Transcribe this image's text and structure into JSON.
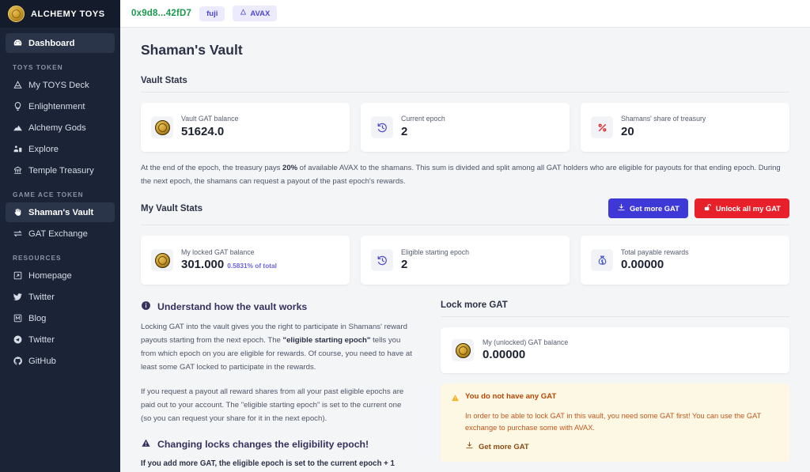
{
  "brand": {
    "name": "ALCHEMY TOYS",
    "logo_icon": "gold-coin-icon"
  },
  "sidebar": {
    "top_items": [
      {
        "label": "Dashboard",
        "icon": "dashboard-icon",
        "active": true
      }
    ],
    "groups": [
      {
        "title": "TOYS TOKEN",
        "items": [
          {
            "label": "My TOYS Deck",
            "icon": "deck-icon"
          },
          {
            "label": "Enlightenment",
            "icon": "lightbulb-icon"
          },
          {
            "label": "Alchemy Gods",
            "icon": "mountain-icon"
          },
          {
            "label": "Explore",
            "icon": "explore-icon"
          },
          {
            "label": "Temple Treasury",
            "icon": "temple-icon"
          }
        ]
      },
      {
        "title": "GAME ACE TOKEN",
        "items": [
          {
            "label": "Shaman's Vault",
            "icon": "hand-icon",
            "active": true
          },
          {
            "label": "GAT Exchange",
            "icon": "exchange-icon"
          }
        ]
      },
      {
        "title": "RESOURCES",
        "items": [
          {
            "label": "Homepage",
            "icon": "external-link-icon"
          },
          {
            "label": "Twitter",
            "icon": "twitter-bird-icon"
          },
          {
            "label": "Blog",
            "icon": "medium-icon"
          },
          {
            "label": "Twitter",
            "icon": "telegram-icon"
          },
          {
            "label": "GitHub",
            "icon": "github-icon"
          }
        ]
      }
    ]
  },
  "topbar": {
    "wallet_address": "0x9d8...42fD7",
    "network_chip": "fuji",
    "token_chip": "AVAX",
    "token_chip_icon": "avax-icon"
  },
  "page": {
    "title": "Shaman's Vault",
    "vault_stats_title": "Vault Stats",
    "my_vault_stats_title": "My Vault Stats",
    "description_pre": "At the end of the epoch, the treasury pays ",
    "description_bold": "20%",
    "description_post": " of available AVAX to the shamans. This sum is divided and split among all GAT holders who are eligible for payouts for that ending epoch. During the next epoch, the shamans can request a payout of the past epoch's rewards."
  },
  "vault_stats": [
    {
      "label": "Vault GAT balance",
      "value": "51624.0",
      "icon": "gold-coin-icon"
    },
    {
      "label": "Current epoch",
      "value": "2",
      "icon": "clock-rewind-icon"
    },
    {
      "label": "Shamans' share of treasury",
      "value": "20",
      "icon": "percent-icon"
    }
  ],
  "my_vault_stats": [
    {
      "label": "My locked GAT balance",
      "value": "301.000",
      "sub": "0.5831% of total",
      "icon": "gold-coin-icon"
    },
    {
      "label": "Eligible starting epoch",
      "value": "2",
      "sub": "",
      "icon": "clock-rewind-icon"
    },
    {
      "label": "Total payable rewards",
      "value": "0.00000",
      "sub": "",
      "icon": "money-bag-icon"
    }
  ],
  "actions": {
    "get_more_gat": "Get more GAT",
    "get_more_gat_icon": "download-icon",
    "unlock_all": "Unlock all my GAT",
    "unlock_all_icon": "unlock-icon"
  },
  "info": {
    "heading": "Understand how the vault works",
    "heading_icon": "info-circle-icon",
    "p1_a": "Locking GAT into the vault gives you the right to participate in Shamans' reward payouts starting from the next epoch. The ",
    "p1_b": "\"eligible starting epoch\"",
    "p1_c": " tells you from which epoch on you are eligible for rewards. Of course, you need to have at least some GAT locked to participate in the rewards.",
    "p2": "If you request a payout all reward shares from all your past eligible epochs are paid out to your account. The \"eligible starting epoch\" is set to the current one (so you can request your share for it in the next epoch).",
    "warn_heading": "Changing locks changes the eligibility epoch!",
    "warn_heading_icon": "warning-triangle-icon",
    "warn_line": "If you add more GAT, the eligible epoch is set to the current epoch + 1"
  },
  "lock_more": {
    "title": "Lock more GAT",
    "balance_label": "My (unlocked) GAT balance",
    "balance_value": "0.00000",
    "balance_icon": "gold-coin-icon",
    "alert_icon": "warning-triangle-icon",
    "alert_title": "You do not have any GAT",
    "alert_body": "In order to be able to lock GAT in this vault, you need some GAT first! You can use the GAT exchange to purchase some with AVAX.",
    "alert_link": "Get more GAT",
    "alert_link_icon": "download-icon"
  },
  "colors": {
    "sidebar_bg": "#1b2436",
    "accent_indigo": "#3d38d6",
    "danger_red": "#e8202a",
    "address_green": "#1a9a4e",
    "warning_bg": "#fdf8e3",
    "warning_text": "#c2571d",
    "gold": "#c99a2a"
  }
}
